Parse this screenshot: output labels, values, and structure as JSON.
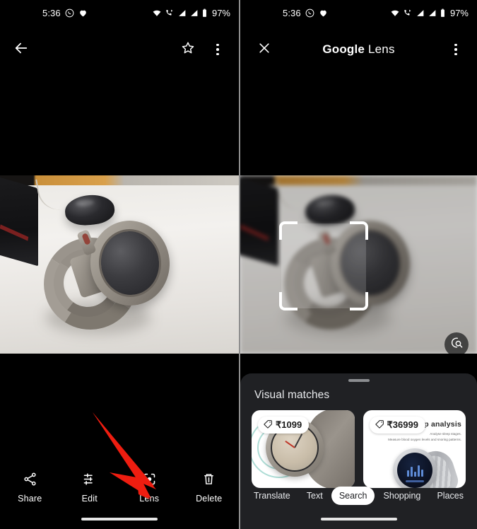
{
  "status_bar": {
    "time": "5:36",
    "battery_percent": "97%",
    "icons": [
      "whatsapp-icon",
      "heart-icon",
      "wifi-icon",
      "call-forward-icon",
      "signal-icon-1",
      "signal-icon-2",
      "battery-icon"
    ]
  },
  "left_panel": {
    "app_bar": {
      "back_icon": "back-arrow-icon",
      "star_icon": "star-outline-icon",
      "more_icon": "more-vert-icon"
    },
    "photo_alt": "smartwatch-photo",
    "toolbar": [
      {
        "label": "Share",
        "icon": "share-icon"
      },
      {
        "label": "Edit",
        "icon": "tune-icon"
      },
      {
        "label": "Lens",
        "icon": "lens-icon"
      },
      {
        "label": "Delete",
        "icon": "trash-icon"
      }
    ],
    "annotation": "red-arrow-pointing-to-lens"
  },
  "right_panel": {
    "app_bar": {
      "close_icon": "close-icon",
      "title_bold": "Google",
      "title_light": " Lens",
      "more_icon": "more-vert-icon"
    },
    "crop_frame": "lens-selection-frame",
    "fab_icon": "search-within-image-icon",
    "sheet": {
      "title": "Visual matches",
      "cards": [
        {
          "price": "₹1099",
          "tag_icon": "price-tag-icon",
          "alt": "rose-gold-smartwatch"
        },
        {
          "price": "₹36999",
          "tag_icon": "price-tag-icon",
          "alt": "sleep-analysis-smartwatch-ad",
          "ad_heading": "...ep analysis",
          "ad_line1": "Analyse sleep stages.",
          "ad_line2": "Measure blood oxygen levels and snoring patterns."
        }
      ]
    },
    "tabs": [
      {
        "label": "Translate",
        "active": false
      },
      {
        "label": "Text",
        "active": false
      },
      {
        "label": "Search",
        "active": true
      },
      {
        "label": "Shopping",
        "active": false
      },
      {
        "label": "Places",
        "active": false
      }
    ]
  },
  "colors": {
    "accent_red": "#ee1d10",
    "sheet_bg": "#202124",
    "active_tab_bg": "#ffffff"
  }
}
